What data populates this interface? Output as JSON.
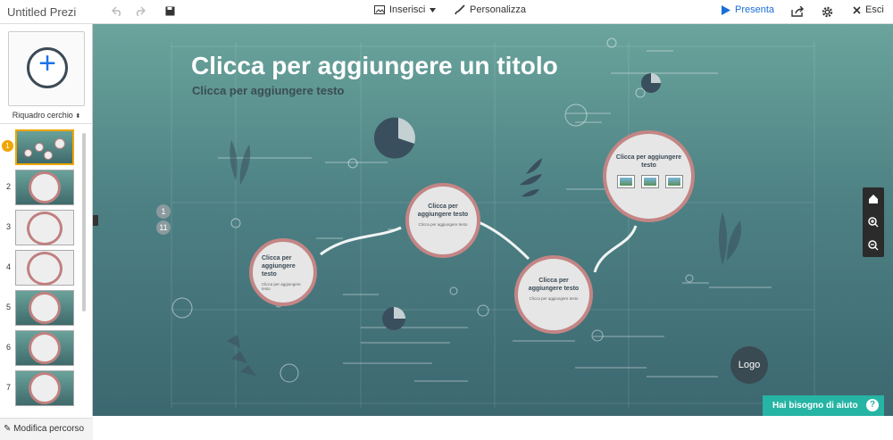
{
  "app": {
    "title": "Untitled Prezi",
    "insert_label": "Inserisci",
    "customize_label": "Personalizza",
    "present_label": "Presenta",
    "exit_label": "Esci"
  },
  "sidebar": {
    "frame_type": "Riquadro cerchio",
    "slides": [
      {
        "num": "1"
      },
      {
        "num": "2"
      },
      {
        "num": "3"
      },
      {
        "num": "4"
      },
      {
        "num": "5"
      },
      {
        "num": "6"
      },
      {
        "num": "7"
      }
    ],
    "edit_path_label": "Modifica percorso"
  },
  "canvas": {
    "title": "Clicca per aggiungere un titolo",
    "subtitle": "Clicca per aggiungere testo",
    "badges": [
      "1",
      "11"
    ],
    "nodes": [
      {
        "title": "Clicca per aggiungere testo",
        "body": "Clicca per aggiungere testo"
      },
      {
        "title": "Clicca per aggiungere testo",
        "body": "Clicca per aggiungere testo"
      },
      {
        "title": "Clicca per aggiungere testo",
        "body": "Clicca per aggiungere testo"
      },
      {
        "title": "Clicca per aggiungere testo",
        "body": ""
      }
    ],
    "logo_label": "Logo",
    "help_label": "Hai bisogno di aiuto",
    "help_icon": "?"
  },
  "colors": {
    "accent": "#1a6fd6",
    "active_slide": "#f0a500",
    "help": "#26b4a4",
    "node_border": "#c48585"
  }
}
